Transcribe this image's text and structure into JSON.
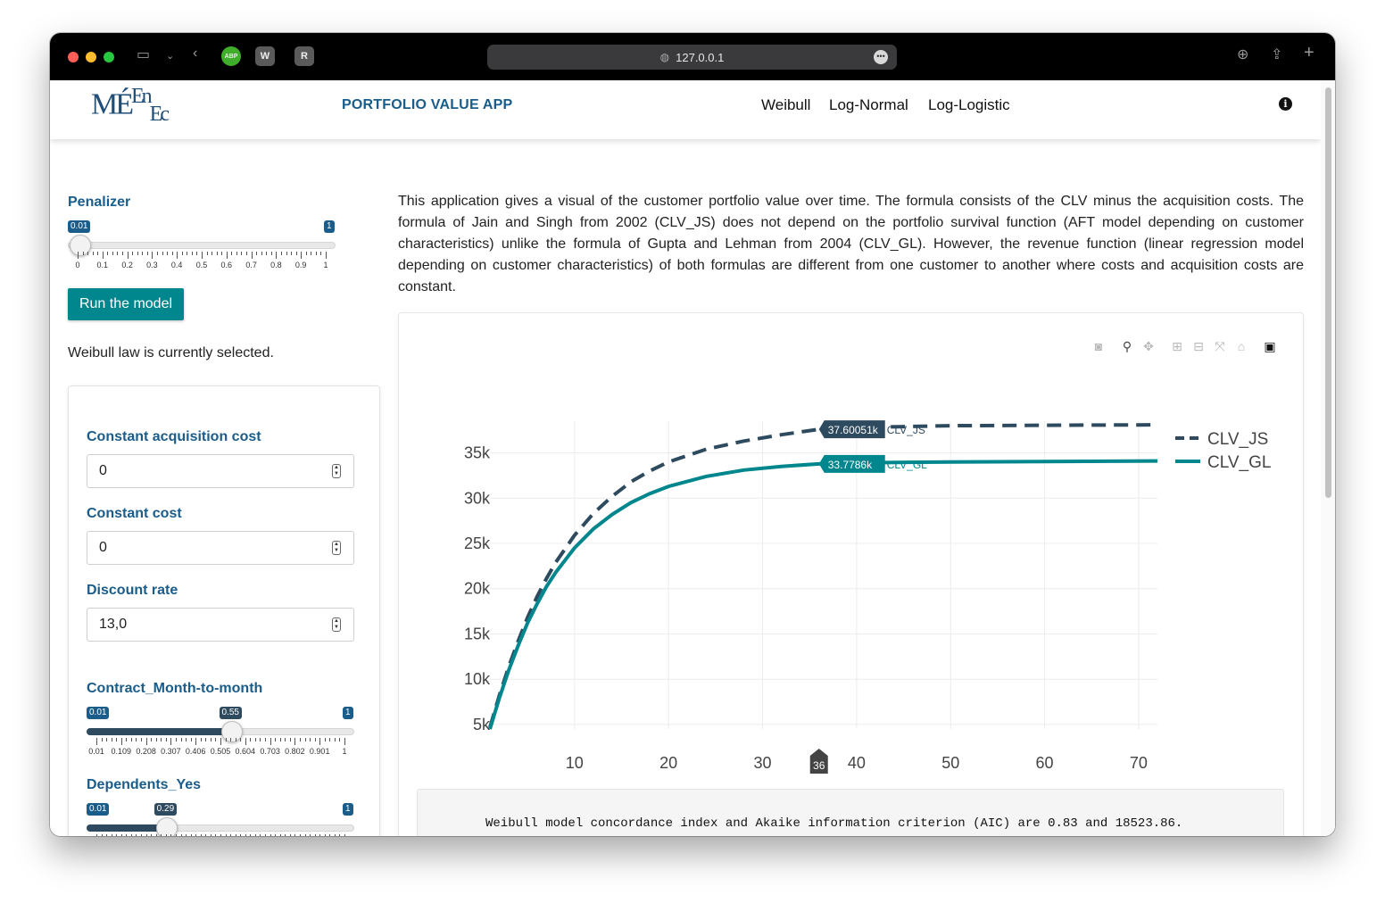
{
  "browser": {
    "address": "127.0.0.1",
    "badges": [
      "ABP",
      "W",
      "R"
    ]
  },
  "navbar": {
    "logo_main": "MÉ",
    "logo_sup": "En",
    "logo_sub": "Ec",
    "app_title": "PORTFOLIO VALUE APP",
    "items": [
      "Weibull",
      "Log-Normal",
      "Log-Logistic"
    ]
  },
  "sidebar": {
    "penalizer": {
      "label": "Penalizer",
      "min_tag": "0.01",
      "max_tag": "1",
      "value": 0.01,
      "tick_labels": [
        "0",
        "0.1",
        "0.2",
        "0.3",
        "0.4",
        "0.5",
        "0.6",
        "0.7",
        "0.8",
        "0.9",
        "1"
      ]
    },
    "run_button": "Run the model",
    "status": "Weibull law is currently selected.",
    "inputs": [
      {
        "label": "Constant acquisition cost",
        "value": "0"
      },
      {
        "label": "Constant cost",
        "value": "0"
      },
      {
        "label": "Discount rate",
        "value": "13,0"
      }
    ],
    "sliders": [
      {
        "label": "Contract_Month-to-month",
        "min_tag": "0.01",
        "value_tag": "0.55",
        "max_tag": "1",
        "fraction": 0.545
      },
      {
        "label": "Dependents_Yes",
        "min_tag": "0.01",
        "value_tag": "0.29",
        "max_tag": "1",
        "fraction": 0.283
      }
    ],
    "slider_tick_labels": [
      "0.01",
      "0.109",
      "0.208",
      "0.307",
      "0.406",
      "0.505",
      "0.604",
      "0.703",
      "0.802",
      "0.901",
      "1"
    ]
  },
  "main": {
    "description": "This application gives a visual of the customer portfolio value over time. The formula consists of the CLV minus the acquisition costs. The formula of Jain and Singh from 2002 (CLV_JS) does not depend on the portfolio survival function (AFT model depending on customer characteristics) unlike the formula of Gupta and Lehman from 2004 (CLV_GL). However, the revenue function (linear regression model depending on customer characteristics) of both formulas are different from one customer to another where costs and acquisition costs are constant.",
    "result": "Weibull model concordance index and Akaike information criterion (AIC) are 0.83 and 18523.86."
  },
  "modebar_icons": [
    "camera-icon",
    "zoom-icon",
    "pan-icon",
    "zoom-in-icon",
    "zoom-out-icon",
    "autoscale-icon",
    "reset-axes-icon",
    "plotly-logo-icon"
  ],
  "chart_data": {
    "type": "line",
    "xlim": [
      1,
      72
    ],
    "ylim": [
      4500,
      38500
    ],
    "x_ticks": [
      10,
      20,
      30,
      40,
      50,
      60,
      70
    ],
    "y_ticks": [
      5000,
      10000,
      15000,
      20000,
      25000,
      30000,
      35000
    ],
    "y_tick_labels": [
      "5k",
      "10k",
      "15k",
      "20k",
      "25k",
      "30k",
      "35k"
    ],
    "grid": true,
    "legend_position": "top-right",
    "hover": {
      "x": 36,
      "x_label": "36",
      "labels": [
        {
          "series": "CLV_JS",
          "value_text": "37.60051k"
        },
        {
          "series": "CLV_GL",
          "value_text": "33.7786k"
        }
      ]
    },
    "series": [
      {
        "name": "CLV_JS",
        "color": "#2e4a5f",
        "dash": "dash",
        "x": [
          1,
          2,
          3,
          4,
          5,
          6,
          7,
          8,
          10,
          12,
          14,
          16,
          18,
          20,
          24,
          28,
          32,
          36,
          40,
          50,
          60,
          72
        ],
        "y": [
          4700,
          8200,
          11400,
          14200,
          16800,
          19100,
          21100,
          22900,
          25900,
          28300,
          30200,
          31800,
          33000,
          34000,
          35400,
          36300,
          37000,
          37600,
          37800,
          38000,
          38050,
          38100
        ]
      },
      {
        "name": "CLV_GL",
        "color": "#00868d",
        "dash": "solid",
        "x": [
          1,
          2,
          3,
          4,
          5,
          6,
          7,
          8,
          10,
          12,
          14,
          16,
          18,
          20,
          24,
          28,
          32,
          36,
          40,
          50,
          60,
          72
        ],
        "y": [
          4500,
          7900,
          11000,
          13700,
          16200,
          18300,
          20200,
          21800,
          24500,
          26600,
          28200,
          29500,
          30500,
          31300,
          32400,
          33100,
          33500,
          33780,
          33900,
          34000,
          34050,
          34100
        ]
      }
    ]
  }
}
